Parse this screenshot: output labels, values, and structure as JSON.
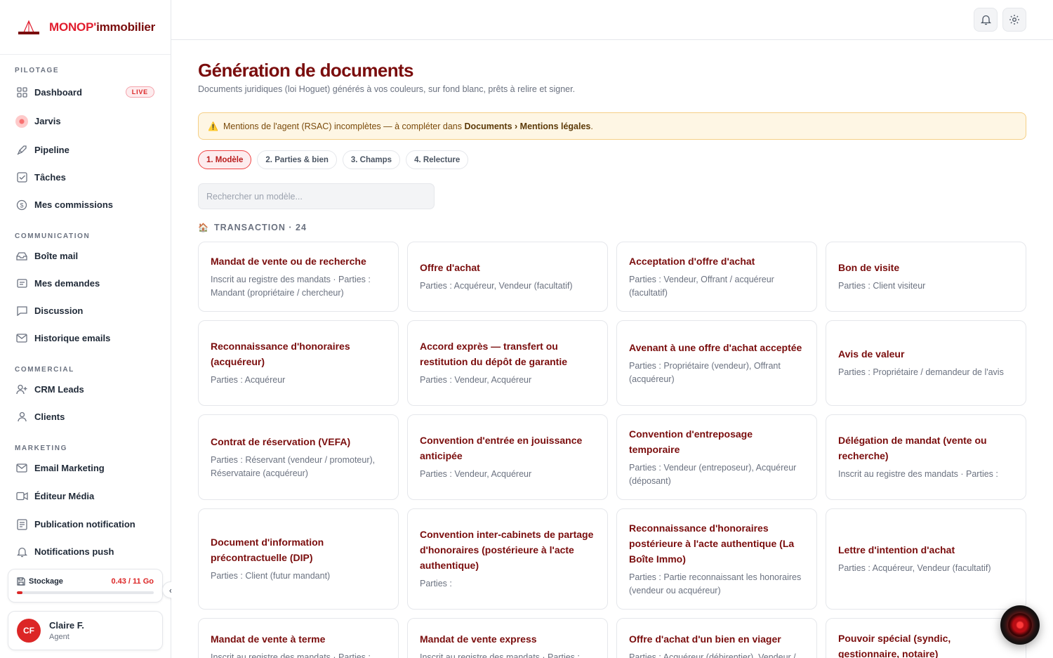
{
  "brand": {
    "name_red": "MONOP'",
    "name_dark": "immobilier"
  },
  "sidebar": {
    "sections": [
      {
        "title": "PILOTAGE",
        "items": [
          {
            "label": "Dashboard",
            "icon": "grid-icon",
            "badge": "LIVE"
          },
          {
            "label": "Jarvis",
            "icon": "jarvis-orb-icon"
          },
          {
            "label": "Pipeline",
            "icon": "rocket-icon"
          },
          {
            "label": "Tâches",
            "icon": "checkbox-icon"
          },
          {
            "label": "Mes commissions",
            "icon": "dollar-circle-icon"
          }
        ]
      },
      {
        "title": "COMMUNICATION",
        "items": [
          {
            "label": "Boîte mail",
            "icon": "inbox-icon"
          },
          {
            "label": "Mes demandes",
            "icon": "message-square-icon"
          },
          {
            "label": "Discussion",
            "icon": "chat-icon"
          },
          {
            "label": "Historique emails",
            "icon": "mail-icon"
          }
        ]
      },
      {
        "title": "COMMERCIAL",
        "items": [
          {
            "label": "CRM Leads",
            "icon": "user-plus-icon"
          },
          {
            "label": "Clients",
            "icon": "user-icon"
          }
        ]
      },
      {
        "title": "MARKETING",
        "items": [
          {
            "label": "Email Marketing",
            "icon": "mail-icon"
          },
          {
            "label": "Éditeur Média",
            "icon": "video-icon"
          },
          {
            "label": "Publication notification",
            "icon": "newspaper-icon"
          },
          {
            "label": "Notifications push",
            "icon": "bell-icon"
          }
        ]
      }
    ],
    "storage": {
      "label": "Stockage",
      "value": "0.43 / 11 Go",
      "fraction": 0.04
    },
    "user": {
      "initials": "CF",
      "name": "Claire F.",
      "role": "Agent"
    }
  },
  "topbar": {
    "buttons": [
      "bell-icon",
      "gear-icon"
    ]
  },
  "main": {
    "title": "Génération de documents",
    "subtitle": "Documents juridiques (loi Hoguet) générés à vos couleurs, sur fond blanc, prêts à relire et signer.",
    "alert": {
      "text_before": "Mentions de l'agent (RSAC) incomplètes — à compléter dans ",
      "link": "Documents › Mentions légales",
      "text_after": "."
    },
    "steps": [
      "1. Modèle",
      "2. Parties & bien",
      "3. Champs",
      "4. Relecture"
    ],
    "active_step": 0,
    "search_placeholder": "Rechercher un modèle...",
    "group": {
      "title": "TRANSACTION · 24",
      "icon": "house-icon"
    },
    "cards": [
      {
        "title": "Mandat de vente ou de recherche",
        "parties": "Inscrit au registre des mandats · Parties : Mandant (propriétaire / chercheur)"
      },
      {
        "title": "Offre d'achat",
        "parties": "Parties : Acquéreur, Vendeur (facultatif)"
      },
      {
        "title": "Acceptation d'offre d'achat",
        "parties": "Parties : Vendeur, Offrant / acquéreur (facultatif)"
      },
      {
        "title": "Bon de visite",
        "parties": "Parties : Client visiteur"
      },
      {
        "title": "Reconnaissance d'honoraires (acquéreur)",
        "parties": "Parties : Acquéreur"
      },
      {
        "title": "Accord exprès — transfert ou restitution du dépôt de garantie",
        "parties": "Parties : Vendeur, Acquéreur"
      },
      {
        "title": "Avenant à une offre d'achat acceptée",
        "parties": "Parties : Propriétaire (vendeur), Offrant (acquéreur)"
      },
      {
        "title": "Avis de valeur",
        "parties": "Parties : Propriétaire / demandeur de l'avis"
      },
      {
        "title": "Contrat de réservation (VEFA)",
        "parties": "Parties : Réservant (vendeur / promoteur), Réservataire (acquéreur)"
      },
      {
        "title": "Convention d'entrée en jouissance anticipée",
        "parties": "Parties : Vendeur, Acquéreur"
      },
      {
        "title": "Convention d'entreposage temporaire",
        "parties": "Parties : Vendeur (entreposeur), Acquéreur (déposant)"
      },
      {
        "title": "Délégation de mandat (vente ou recherche)",
        "parties": "Inscrit au registre des mandats · Parties :"
      },
      {
        "title": "Document d'information précontractuelle (DIP)",
        "parties": "Parties : Client (futur mandant)"
      },
      {
        "title": "Convention inter-cabinets de partage d'honoraires (postérieure à l'acte authentique)",
        "parties": "Parties :"
      },
      {
        "title": "Reconnaissance d'honoraires postérieure à l'acte authentique (La Boîte Immo)",
        "parties": "Parties : Partie reconnaissant les honoraires (vendeur ou acquéreur)"
      },
      {
        "title": "Lettre d'intention d'achat",
        "parties": "Parties : Acquéreur, Vendeur (facultatif)"
      },
      {
        "title": "Mandat de vente à terme",
        "parties": "Inscrit au registre des mandats · Parties :"
      },
      {
        "title": "Mandat de vente express",
        "parties": "Inscrit au registre des mandats · Parties :"
      },
      {
        "title": "Offre d'achat d'un bien en viager",
        "parties": "Parties : Acquéreur (débirentier), Vendeur /"
      },
      {
        "title": "Pouvoir spécial (syndic, gestionnaire, notaire)",
        "parties": ""
      }
    ]
  }
}
